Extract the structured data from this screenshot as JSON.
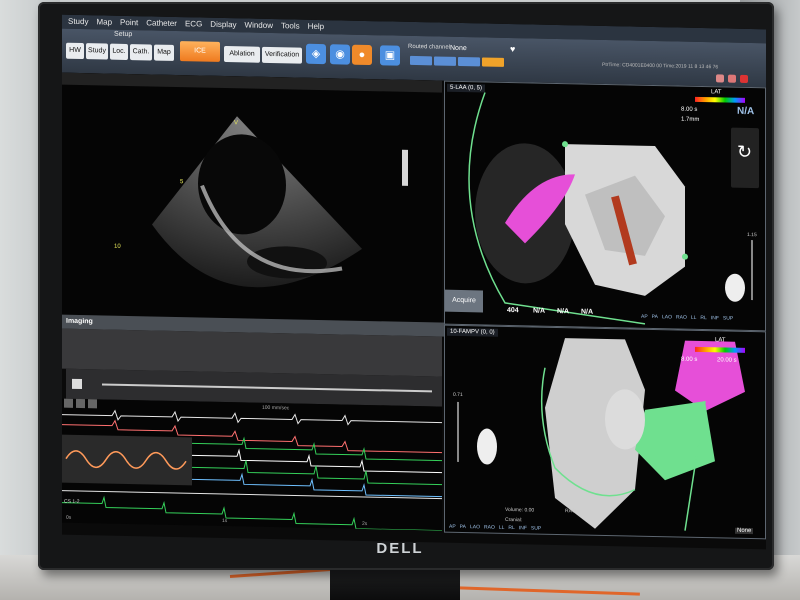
{
  "menu": {
    "items": [
      "Study",
      "Map",
      "Point",
      "Catheter",
      "ECG",
      "Display",
      "Window",
      "Tools",
      "Help"
    ]
  },
  "toolbar": {
    "setup_label": "Setup",
    "buttons": [
      {
        "label": "HW"
      },
      {
        "label": "Study"
      },
      {
        "label": "Loc."
      },
      {
        "label": "Cath."
      },
      {
        "label": "Map"
      },
      {
        "label": "ICE",
        "active": true
      },
      {
        "label": "Ablation"
      },
      {
        "label": "Verification"
      }
    ],
    "routed_channel_label": "Routed channel",
    "routed_channel_value": "None",
    "status_text": "PtrTime: CD4001E0400 00   Time:2019 11 8 13 46 76"
  },
  "echo": {
    "labels": [
      "V",
      "5",
      "10"
    ],
    "imaging_label": "Imaging"
  },
  "ecg": {
    "speed_label": "100 mm/sec",
    "lead_label": "CS 1-2",
    "tick_labels": [
      "0s",
      "1s",
      "2s"
    ]
  },
  "map_top": {
    "title": "5-LAA (0, 5)",
    "legend": {
      "lat": "LAT",
      "na": "N/A",
      "value1": "8.00 s",
      "value2": "1.7mm"
    },
    "bottom_values": [
      "404",
      "N/A",
      "N/A",
      "N/A"
    ],
    "acquire_label": "Acquire",
    "scale_value": "1.15",
    "nav": [
      "AP",
      "PA",
      "LAO",
      "RAO",
      "LL",
      "RL",
      "INF",
      "SUP"
    ],
    "pa_label": "PA"
  },
  "map_bottom": {
    "title": "10-FAMPV (0, 0)",
    "legend": {
      "lat": "LAT",
      "value1": "8.00 s",
      "value2": "20.00 s"
    },
    "scale_value": "0.71",
    "volume": "Volume: 0.00",
    "cranial": "Cranial:",
    "rao": "RAO",
    "nav": [
      "AP",
      "PA",
      "LAO",
      "RAO",
      "LL",
      "RL",
      "INF",
      "SUP"
    ],
    "name_dropdown": "None"
  },
  "brand": "DELL",
  "colors": {
    "menu_bg": "#2b3440",
    "active_tab": "#ef7a1f",
    "ecg_green": "#35d05a",
    "map_magenta": "#e64fd8",
    "map_green": "#6fe08f"
  }
}
